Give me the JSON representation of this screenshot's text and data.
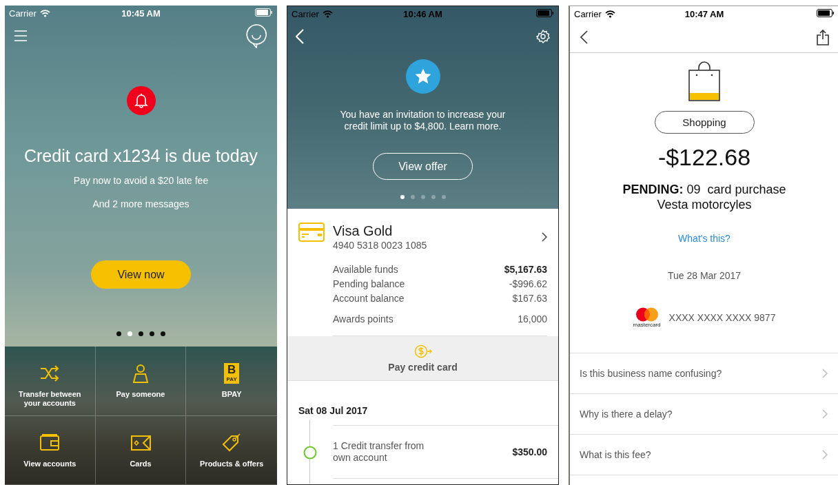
{
  "home_screen": {
    "status_bar": {
      "carrier": "Carrier",
      "time": "10:45 AM"
    },
    "alert": {
      "title": "Credit card x1234 is due today",
      "subtitle": "Pay now to avoid a $20 late fee",
      "more": "And 2 more messages",
      "button": "View now"
    },
    "page_dots": [
      {
        "selected": false
      },
      {
        "selected": true
      },
      {
        "selected": false
      },
      {
        "selected": false
      },
      {
        "selected": false
      }
    ],
    "tiles": [
      {
        "label": "Transfer between your accounts"
      },
      {
        "label": "Pay someone"
      },
      {
        "label": "BPAY",
        "badge_letter": "B",
        "badge_caption": "PAY"
      },
      {
        "label": "View accounts"
      },
      {
        "label": "Cards"
      },
      {
        "label": "Products & offers"
      }
    ]
  },
  "card_screen": {
    "status_bar": {
      "carrier": "Carrier",
      "time": "10:46 AM"
    },
    "offer": {
      "message": "You have an invitation to increase your credit limit up to $4,800. Learn more.",
      "button": "View offer"
    },
    "page_dots": [
      {
        "selected": true
      },
      {
        "selected": false
      },
      {
        "selected": false
      },
      {
        "selected": false
      },
      {
        "selected": false
      }
    ],
    "account": {
      "name": "Visa Gold",
      "number": "4940 5318 0023 1085"
    },
    "balances": [
      {
        "label": "Available funds",
        "value": "$5,167.63",
        "bold": true
      },
      {
        "label": "Pending balance",
        "value": "-$996.62",
        "bold": false
      },
      {
        "label": "Account balance",
        "value": "$167.63",
        "bold": false
      }
    ],
    "points": {
      "label": "Awards points",
      "value": "16,000"
    },
    "pay_action": "Pay credit card",
    "date_header": "Sat 08 Jul 2017",
    "transactions": [
      {
        "description": "1 Credit transfer from own account",
        "amount": "$350.00"
      }
    ]
  },
  "transaction_screen": {
    "status_bar": {
      "carrier": "Carrier",
      "time": "10:47 AM"
    },
    "category": "Shopping",
    "amount": "-$122.68",
    "description": "**PENDING:** 09  card purchase Vesta motorcyles",
    "help_link": "What's this?",
    "date": "Tue 28 Mar 2017",
    "card": {
      "brand": "mastercard",
      "number": "XXXX XXXX XXXX 9877"
    },
    "questions": [
      "Is this business name confusing?",
      "Why is there a delay?",
      "What is this fee?"
    ]
  }
}
